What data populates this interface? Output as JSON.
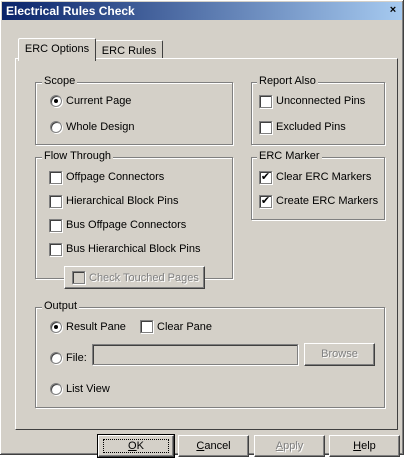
{
  "window": {
    "title": "Electrical Rules Check",
    "close_glyph": "×"
  },
  "tabs": [
    {
      "label": "ERC Options",
      "active": true
    },
    {
      "label": "ERC Rules",
      "active": false
    }
  ],
  "scope": {
    "legend": "Scope",
    "options": [
      {
        "label": "Current Page",
        "selected": true
      },
      {
        "label": "Whole Design",
        "selected": false
      }
    ]
  },
  "report_also": {
    "legend": "Report Also",
    "options": [
      {
        "label": "Unconnected Pins",
        "checked": false
      },
      {
        "label": "Excluded Pins",
        "checked": false
      }
    ]
  },
  "flow_through": {
    "legend": "Flow Through",
    "options": [
      {
        "label": "Offpage Connectors",
        "checked": false
      },
      {
        "label": "Hierarchical Block Pins",
        "checked": false
      },
      {
        "label": "Bus Offpage Connectors",
        "checked": false
      },
      {
        "label": "Bus Hierarchical Block Pins",
        "checked": false
      }
    ],
    "check_touched": {
      "label": "Check Touched Pages",
      "checked": false,
      "enabled": false
    }
  },
  "erc_marker": {
    "legend": "ERC Marker",
    "options": [
      {
        "label": "Clear ERC Markers",
        "checked": true
      },
      {
        "label": "Create ERC Markers",
        "checked": true
      }
    ]
  },
  "output": {
    "legend": "Output",
    "result_pane": {
      "label": "Result Pane",
      "selected": true
    },
    "clear_pane": {
      "label": "Clear Pane",
      "checked": false
    },
    "file": {
      "label": "File:",
      "selected": false,
      "value": ""
    },
    "browse": {
      "label": "Browse"
    },
    "list_view": {
      "label": "List View",
      "selected": false
    }
  },
  "buttons": {
    "ok": {
      "label": "OK",
      "mnemonic": "O",
      "rest": "K"
    },
    "cancel": {
      "label": "Cancel",
      "mnemonic": "C",
      "rest": "ancel"
    },
    "apply": {
      "label": "Apply",
      "mnemonic": "A",
      "rest": "pply"
    },
    "help": {
      "label": "Help",
      "mnemonic": "H",
      "rest": "elp"
    }
  },
  "colors": {
    "dialog_bg": "#d4d0c8",
    "title_start": "#0a246a",
    "title_end": "#a6caf0",
    "disabled_text": "#808080"
  }
}
